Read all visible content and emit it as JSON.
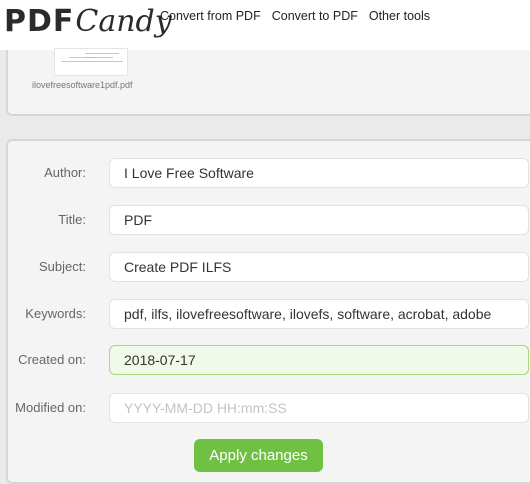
{
  "header": {
    "logo_pdf": "PDF",
    "logo_candy": "Candy",
    "nav": [
      {
        "label": "Convert from PDF"
      },
      {
        "label": "Convert to PDF"
      },
      {
        "label": "Other tools"
      }
    ]
  },
  "file": {
    "name": "ilovefreesoftware1pdf.pdf"
  },
  "form": {
    "fields": [
      {
        "label": "Author:",
        "value": "I Love Free Software"
      },
      {
        "label": "Title:",
        "value": "PDF"
      },
      {
        "label": "Subject:",
        "value": "Create PDF ILFS"
      },
      {
        "label": "Keywords:",
        "value": "pdf, ilfs, ilovefreesoftware, ilovefs, software, acrobat, adobe"
      },
      {
        "label": "Created on:",
        "value": "2018-07-17"
      },
      {
        "label": "Modified on:",
        "value": "",
        "placeholder": "YYYY-MM-DD HH:mm:SS"
      }
    ],
    "apply_label": "Apply changes"
  },
  "colors": {
    "accent": "#6fc043",
    "active_field_border": "#a6d67e",
    "background": "#eaeaea"
  }
}
